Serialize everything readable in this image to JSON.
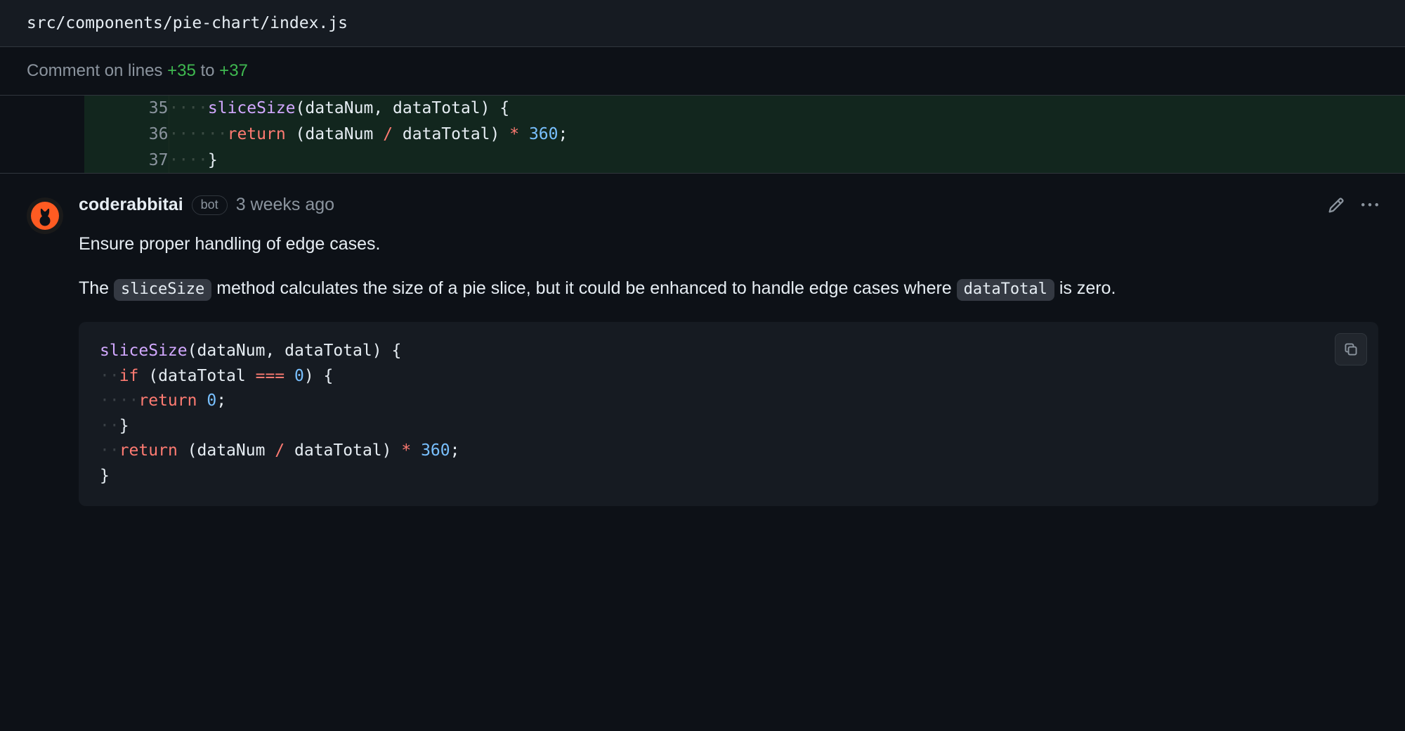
{
  "file": {
    "path": "src/components/pie-chart/index.js"
  },
  "range": {
    "prefix": "Comment on lines ",
    "from": "+35",
    "connector": " to ",
    "to": "+37"
  },
  "diff": {
    "lines": [
      {
        "num": "35",
        "tokens": [
          {
            "cls": "tok-ws",
            "t": "····"
          },
          {
            "cls": "tok-fn",
            "t": "sliceSize"
          },
          {
            "cls": "tok-paren",
            "t": "("
          },
          {
            "cls": "tok-var",
            "t": "dataNum"
          },
          {
            "cls": "tok-punc",
            "t": ", "
          },
          {
            "cls": "tok-var",
            "t": "dataTotal"
          },
          {
            "cls": "tok-paren",
            "t": ")"
          },
          {
            "cls": "tok-punc",
            "t": " {"
          }
        ]
      },
      {
        "num": "36",
        "tokens": [
          {
            "cls": "tok-ws",
            "t": "······"
          },
          {
            "cls": "tok-kw",
            "t": "return"
          },
          {
            "cls": "tok-punc",
            "t": " ("
          },
          {
            "cls": "tok-var",
            "t": "dataNum"
          },
          {
            "cls": "tok-punc",
            "t": " "
          },
          {
            "cls": "tok-op",
            "t": "/"
          },
          {
            "cls": "tok-punc",
            "t": " "
          },
          {
            "cls": "tok-var",
            "t": "dataTotal"
          },
          {
            "cls": "tok-punc",
            "t": ") "
          },
          {
            "cls": "tok-op",
            "t": "*"
          },
          {
            "cls": "tok-punc",
            "t": " "
          },
          {
            "cls": "tok-num",
            "t": "360"
          },
          {
            "cls": "tok-punc",
            "t": ";"
          }
        ]
      },
      {
        "num": "37",
        "tokens": [
          {
            "cls": "tok-ws",
            "t": "····"
          },
          {
            "cls": "tok-punc",
            "t": "}"
          }
        ]
      }
    ]
  },
  "comment": {
    "author": "coderabbitai",
    "bot_label": "bot",
    "timestamp": "3 weeks ago",
    "title": "Ensure proper handling of edge cases.",
    "body_pre": "The ",
    "body_code1": "sliceSize",
    "body_mid": " method calculates the size of a pie slice, but it could be enhanced to handle edge cases where ",
    "body_code2": "dataTotal",
    "body_post": " is zero.",
    "suggestion": [
      [
        {
          "cls": "tok-fn",
          "t": "sliceSize"
        },
        {
          "cls": "tok-paren",
          "t": "("
        },
        {
          "cls": "tok-var",
          "t": "dataNum"
        },
        {
          "cls": "tok-punc",
          "t": ", "
        },
        {
          "cls": "tok-var",
          "t": "dataTotal"
        },
        {
          "cls": "tok-paren",
          "t": ")"
        },
        {
          "cls": "tok-punc",
          "t": " {"
        }
      ],
      [
        {
          "cls": "tok-ws",
          "t": "··"
        },
        {
          "cls": "tok-kw",
          "t": "if"
        },
        {
          "cls": "tok-punc",
          "t": " ("
        },
        {
          "cls": "tok-var",
          "t": "dataTotal"
        },
        {
          "cls": "tok-punc",
          "t": " "
        },
        {
          "cls": "tok-op",
          "t": "==="
        },
        {
          "cls": "tok-punc",
          "t": " "
        },
        {
          "cls": "tok-num",
          "t": "0"
        },
        {
          "cls": "tok-punc",
          "t": ") {"
        }
      ],
      [
        {
          "cls": "tok-ws",
          "t": "····"
        },
        {
          "cls": "tok-kw",
          "t": "return"
        },
        {
          "cls": "tok-punc",
          "t": " "
        },
        {
          "cls": "tok-num",
          "t": "0"
        },
        {
          "cls": "tok-punc",
          "t": ";"
        }
      ],
      [
        {
          "cls": "tok-ws",
          "t": "··"
        },
        {
          "cls": "tok-punc",
          "t": "}"
        }
      ],
      [
        {
          "cls": "tok-ws",
          "t": "··"
        },
        {
          "cls": "tok-kw",
          "t": "return"
        },
        {
          "cls": "tok-punc",
          "t": " ("
        },
        {
          "cls": "tok-var",
          "t": "dataNum"
        },
        {
          "cls": "tok-punc",
          "t": " "
        },
        {
          "cls": "tok-op",
          "t": "/"
        },
        {
          "cls": "tok-punc",
          "t": " "
        },
        {
          "cls": "tok-var",
          "t": "dataTotal"
        },
        {
          "cls": "tok-punc",
          "t": ") "
        },
        {
          "cls": "tok-op",
          "t": "*"
        },
        {
          "cls": "tok-punc",
          "t": " "
        },
        {
          "cls": "tok-num",
          "t": "360"
        },
        {
          "cls": "tok-punc",
          "t": ";"
        }
      ],
      [
        {
          "cls": "tok-punc",
          "t": "}"
        }
      ]
    ]
  },
  "icons": {
    "edit": "pencil-icon",
    "more": "kebab-icon",
    "copy": "copy-icon"
  }
}
